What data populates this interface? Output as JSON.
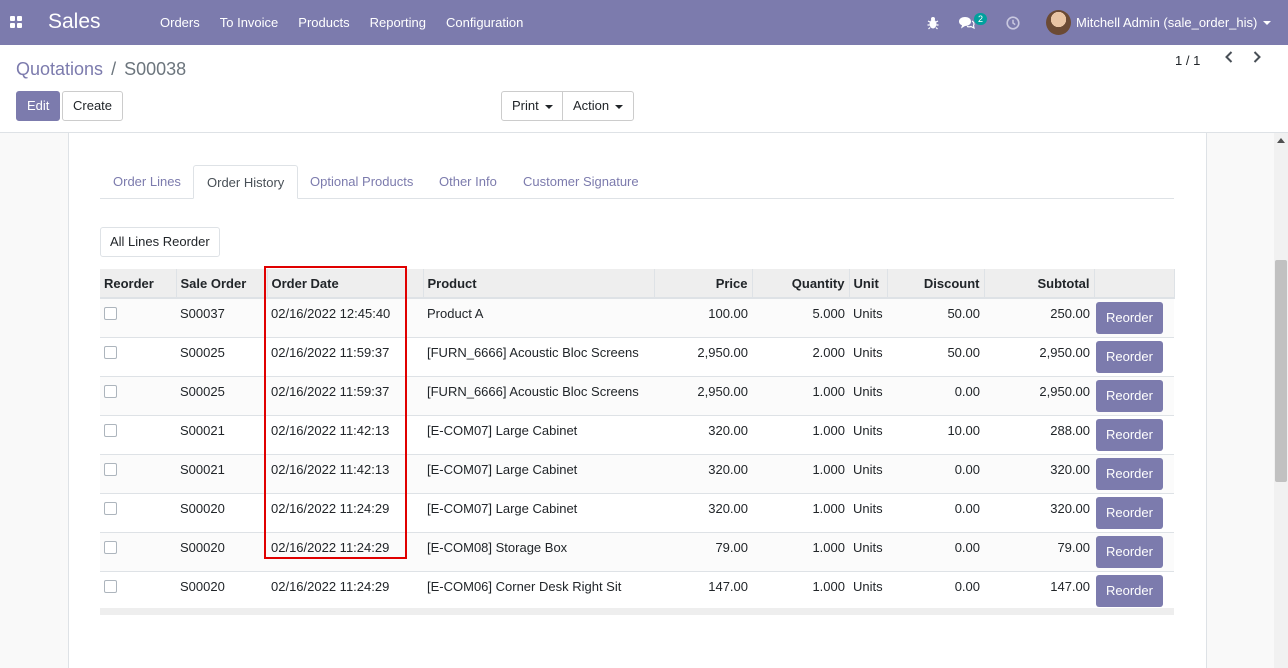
{
  "navbar": {
    "app_name": "Sales",
    "menu": [
      "Orders",
      "To Invoice",
      "Products",
      "Reporting",
      "Configuration"
    ],
    "chat_count": "2",
    "user_name": "Mitchell Admin (sale_order_his)"
  },
  "breadcrumb": {
    "parent": "Quotations",
    "separator": "/",
    "current": "S00038"
  },
  "buttons": {
    "edit": "Edit",
    "create": "Create",
    "print": "Print",
    "action": "Action"
  },
  "pager": {
    "value": "1 / 1"
  },
  "tabs": [
    "Order Lines",
    "Order History",
    "Optional Products",
    "Other Info",
    "Customer Signature"
  ],
  "active_tab": "Order History",
  "all_lines_reorder": "All Lines Reorder",
  "table": {
    "headers": [
      "Reorder",
      "Sale Order",
      "Order Date",
      "Product",
      "Price",
      "Quantity",
      "Unit",
      "Discount",
      "Subtotal"
    ],
    "reorder_label": "Reorder",
    "rows": [
      {
        "order": "S00037",
        "date": "02/16/2022 12:45:40",
        "product": "Product A",
        "price": "100.00",
        "qty": "5.000",
        "unit": "Units",
        "discount": "50.00",
        "subtotal": "250.00"
      },
      {
        "order": "S00025",
        "date": "02/16/2022 11:59:37",
        "product": "[FURN_6666] Acoustic Bloc Screens",
        "price": "2,950.00",
        "qty": "2.000",
        "unit": "Units",
        "discount": "50.00",
        "subtotal": "2,950.00"
      },
      {
        "order": "S00025",
        "date": "02/16/2022 11:59:37",
        "product": "[FURN_6666] Acoustic Bloc Screens",
        "price": "2,950.00",
        "qty": "1.000",
        "unit": "Units",
        "discount": "0.00",
        "subtotal": "2,950.00"
      },
      {
        "order": "S00021",
        "date": "02/16/2022 11:42:13",
        "product": "[E-COM07] Large Cabinet",
        "price": "320.00",
        "qty": "1.000",
        "unit": "Units",
        "discount": "10.00",
        "subtotal": "288.00"
      },
      {
        "order": "S00021",
        "date": "02/16/2022 11:42:13",
        "product": "[E-COM07] Large Cabinet",
        "price": "320.00",
        "qty": "1.000",
        "unit": "Units",
        "discount": "0.00",
        "subtotal": "320.00"
      },
      {
        "order": "S00020",
        "date": "02/16/2022 11:24:29",
        "product": "[E-COM07] Large Cabinet",
        "price": "320.00",
        "qty": "1.000",
        "unit": "Units",
        "discount": "0.00",
        "subtotal": "320.00"
      },
      {
        "order": "S00020",
        "date": "02/16/2022 11:24:29",
        "product": "[E-COM08] Storage Box",
        "price": "79.00",
        "qty": "1.000",
        "unit": "Units",
        "discount": "0.00",
        "subtotal": "79.00"
      },
      {
        "order": "S00020",
        "date": "02/16/2022 11:24:29",
        "product": "[E-COM06] Corner Desk Right Sit",
        "price": "147.00",
        "qty": "1.000",
        "unit": "Units",
        "discount": "0.00",
        "subtotal": "147.00"
      }
    ]
  },
  "colors": {
    "brand": "#7c7bad",
    "highlight": "#e00000"
  }
}
